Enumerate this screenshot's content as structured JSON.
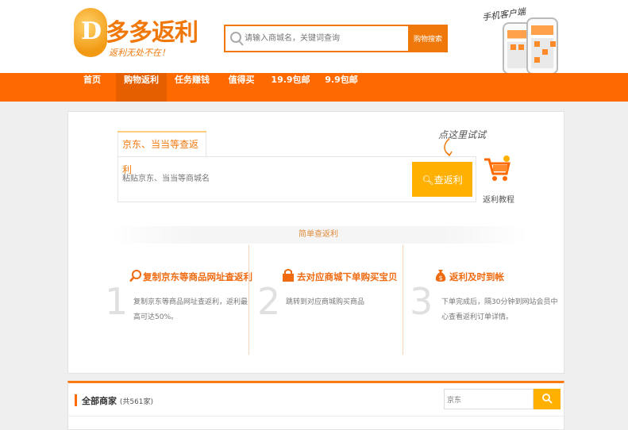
{
  "header": {
    "logo_text": "多多返利",
    "logo_badge": "D",
    "slogan": "返利无处不在！",
    "search": {
      "placeholder": "请输入商城名，关键词查询",
      "button_label": "购物搜索"
    },
    "app_promo_label": "手机客户端"
  },
  "nav": {
    "items": [
      {
        "label": "首页",
        "active": false
      },
      {
        "label": "购物返利",
        "active": true
      },
      {
        "label": "任务赚钱",
        "active": false
      },
      {
        "label": "值得买",
        "active": false
      },
      {
        "label": "19.9包邮",
        "active": false
      },
      {
        "label": "9.9包邮",
        "active": false
      }
    ]
  },
  "query": {
    "tab_label": "京东、当当等查返利",
    "input_placeholder": "粘贴京东、当当等商城名",
    "button_label": "查返利",
    "hint_text": "点这里试试",
    "tutorial_label": "返利教程"
  },
  "steps": {
    "heading": "简单查返利",
    "items": [
      {
        "number": "1",
        "title": "复制京东等商品网址查返利",
        "desc": "复制京东等商品网址查返利，返利最高可达50%。"
      },
      {
        "number": "2",
        "title": "去对应商城下单购买宝贝",
        "desc": "跳转到对应商城购买商品"
      },
      {
        "number": "3",
        "title": "返利及时到帐",
        "desc": "下单完成后，隔30分钟到网站会员中心查看返利订单详情。"
      }
    ]
  },
  "merchants": {
    "title": "全部商家",
    "count": "(共561家)",
    "search_value": "京东"
  },
  "colors": {
    "brand": "#ff6a00",
    "accent_yellow": "#ffb000"
  }
}
